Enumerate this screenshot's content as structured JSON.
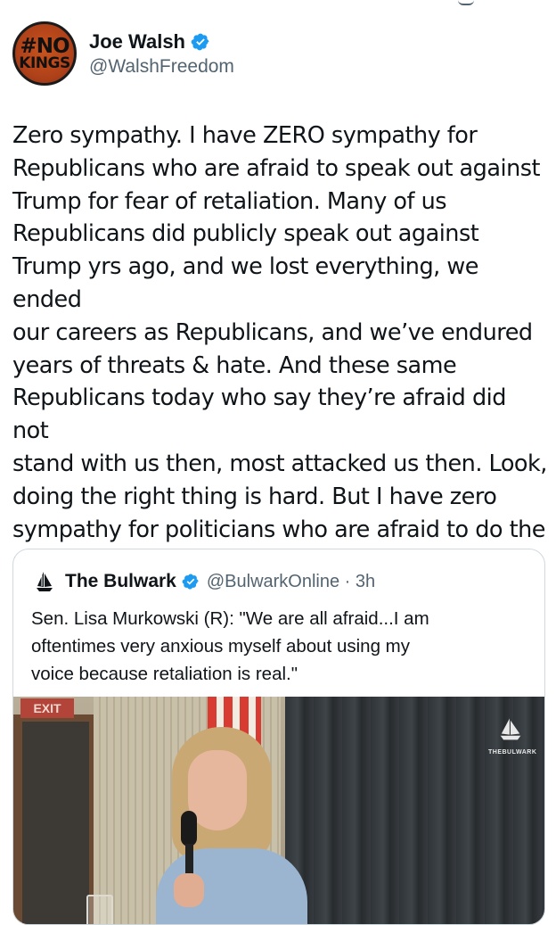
{
  "tweet": {
    "author": {
      "display_name": "Joe Walsh",
      "handle": "@WalshFreedom",
      "avatar_text_line1": "#NO",
      "avatar_text_line2": "KINGS",
      "verified_icon": "verified-badge-icon"
    },
    "text": "Zero sympathy. I have ZERO sympathy for\nRepublicans who are afraid to speak out against\nTrump for fear of retaliation. Many of us\nRepublicans did publicly speak out against\nTrump yrs ago, and we lost everything, we ended\nour careers as Republicans, and we’ve endured\nyears of threats & hate. And these same\nRepublicans today who say they’re afraid did not\nstand with us then, most attacked us then. Look,\ndoing the right thing is hard. But I have zero\nsympathy for politicians who are afraid to do the\nright thing."
  },
  "quote": {
    "display_name": "The Bulwark",
    "handle_time": "@BulwarkOnline · 3h",
    "text": "Sen. Lisa Murkowski (R): \"We are all afraid...I am\noftentimes very anxious myself about using my\nvoice because retaliation is real.\"",
    "media": {
      "exit_sign": "EXIT",
      "watermark": "THEBULWARK"
    }
  },
  "colors": {
    "verified_blue": "#1d9bf0",
    "secondary_text": "#536471",
    "border": "#cfd9de"
  }
}
